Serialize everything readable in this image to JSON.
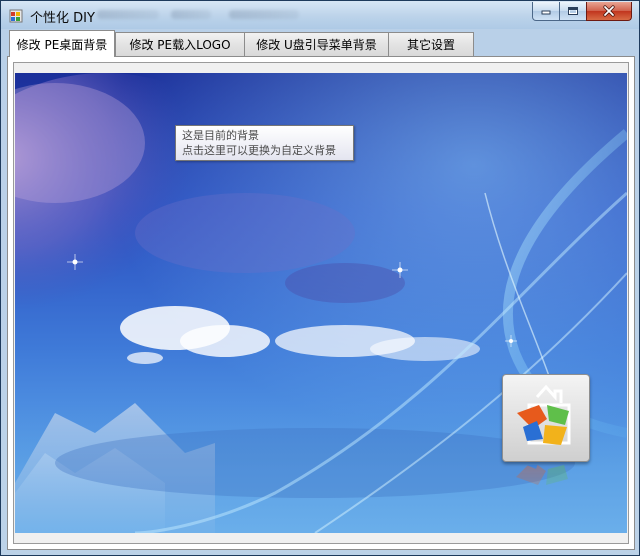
{
  "window": {
    "title": "个性化 DIY",
    "icon": "app-icon",
    "buttons": {
      "minimize": "minimize-icon",
      "maximize": "maximize-icon",
      "close": "close-icon"
    }
  },
  "tabs": [
    {
      "label": "修改 PE桌面背景",
      "active": true
    },
    {
      "label": "修改 PE载入LOGO",
      "active": false
    },
    {
      "label": "修改 U盘引导菜单背景",
      "active": false
    },
    {
      "label": "其它设置",
      "active": false
    }
  ],
  "background_preview": {
    "tooltip": {
      "line1": "这是目前的背景",
      "line2": "点击这里可以更换为自定义背景"
    },
    "logo_icon": "start-menu-logo-icon"
  },
  "colors": {
    "close_button": "#c1351e",
    "sky_top": "#1b2f9a",
    "sky_bottom": "#6cb3ef"
  }
}
